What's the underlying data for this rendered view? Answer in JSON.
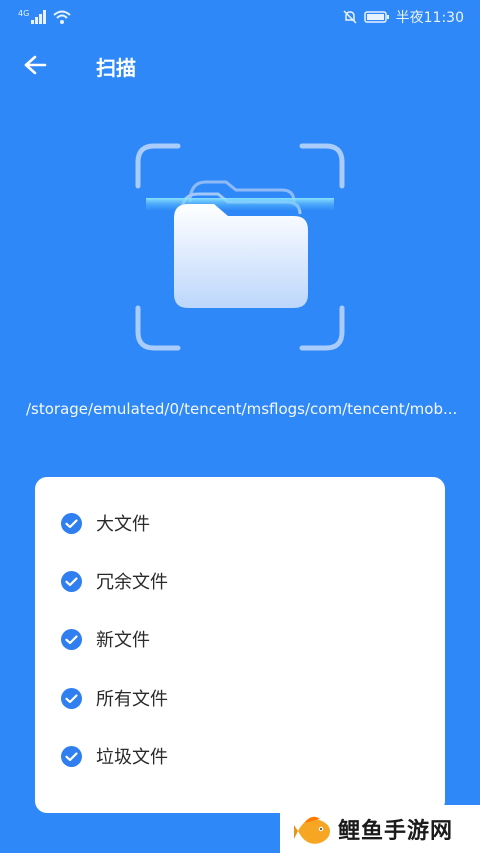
{
  "status_bar": {
    "network_label": "4G",
    "time": "半夜11:30"
  },
  "header": {
    "title": "扫描",
    "back_icon": "arrow-left-icon"
  },
  "scan": {
    "current_path": "/storage/emulated/0/tencent/msflogs/com/tencent/mob..."
  },
  "card": {
    "items": [
      {
        "label": "大文件",
        "checked": true
      },
      {
        "label": "冗余文件",
        "checked": true
      },
      {
        "label": "新文件",
        "checked": true
      },
      {
        "label": "所有文件",
        "checked": true
      },
      {
        "label": "垃圾文件",
        "checked": true
      }
    ]
  },
  "watermark": {
    "text": "鲤鱼手游网"
  },
  "colors": {
    "background": "#2f88f7",
    "check": "#2f7ff0",
    "card": "#ffffff"
  }
}
